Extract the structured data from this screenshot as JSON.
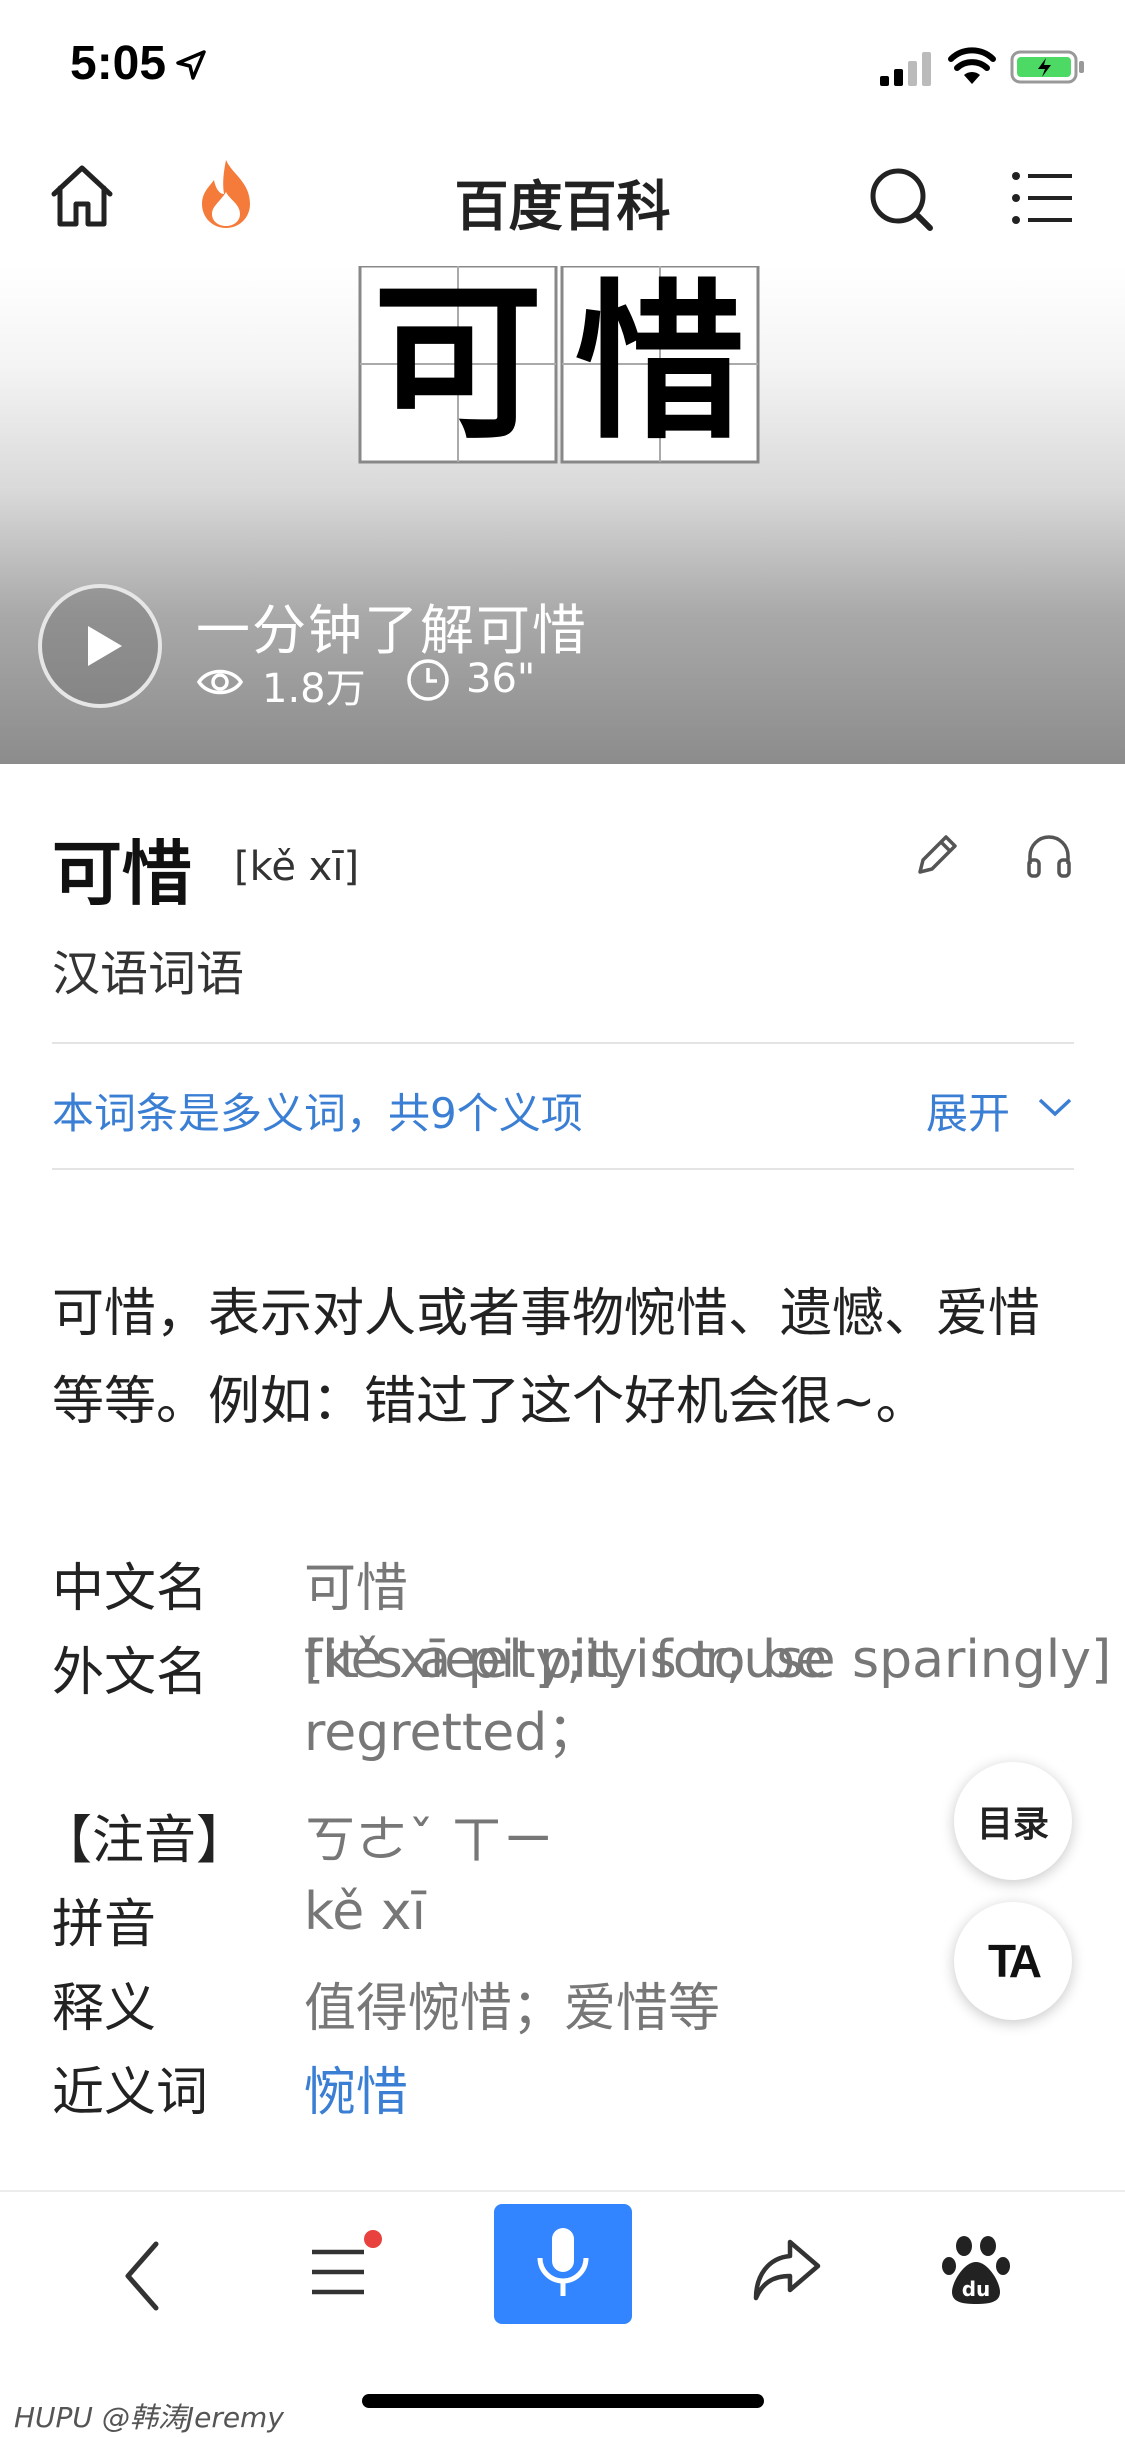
{
  "status_bar": {
    "time": "5:05"
  },
  "nav": {
    "title": "百度百科"
  },
  "video": {
    "title": "一分钟了解可惜",
    "views": "1.8万",
    "duration": "36\"",
    "characters": [
      "可",
      "惜"
    ]
  },
  "entry": {
    "title": "可惜",
    "pinyin": "[kě xī]",
    "subtitle": "汉语词语",
    "polysemy_text": "本词条是多义词，共9个义项",
    "expand_label": "展开",
    "summary": "可惜，表示对人或者事物惋惜、遗憾、爱惜等等。例如：错过了这个好机会很~。"
  },
  "infobox": [
    {
      "label": "中文名",
      "value": "可惜"
    },
    {
      "label": "外文名",
      "value": "[it’s a pity;it is to be regretted；",
      "value2": "fkě xīeel pity for;use sparingly]"
    },
    {
      "label": "【注音】",
      "value": "ㄎㄜˇ ㄒㄧ"
    },
    {
      "label": "拼音",
      "value": "kě xī"
    },
    {
      "label": "释义",
      "value": "值得惋惜；爱惜等"
    },
    {
      "label": "近义词",
      "value": "惋惜"
    }
  ],
  "fabs": {
    "toc": "目录",
    "ta": "TA"
  },
  "watermark": "HUPU @韩涛Jeremy",
  "colors": {
    "accent_blue": "#3b7fd4",
    "mic_blue": "#3385ff",
    "hot_orange": "#f47b3a",
    "badge_red": "#e8413e",
    "battery_green": "#4cd964"
  },
  "icons": [
    "location-arrow-icon",
    "signal-icon",
    "wifi-icon",
    "battery-icon",
    "home-icon",
    "hot-flame-icon",
    "search-icon",
    "menu-icon",
    "play-icon",
    "eye-icon",
    "clock-icon",
    "edit-pencil-icon",
    "headphones-icon",
    "chevron-down-icon",
    "back-icon",
    "list-icon",
    "mic-icon",
    "share-icon",
    "baidu-paw-icon"
  ]
}
